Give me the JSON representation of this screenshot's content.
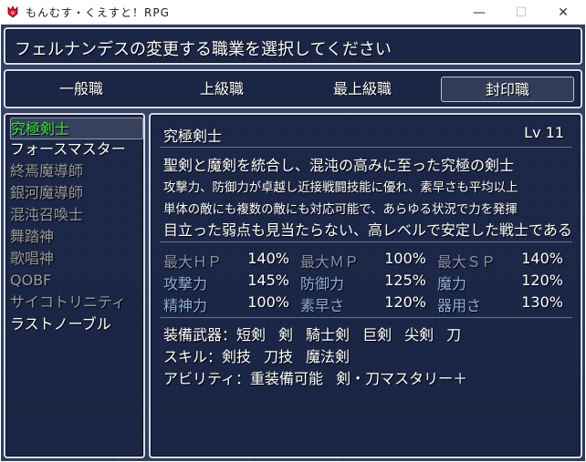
{
  "window": {
    "title": "もんむす・くえすと！RPG",
    "minimize_glyph": "—",
    "maximize_glyph": "☐",
    "close_glyph": "✕"
  },
  "header": {
    "text": "フェルナンデスの変更する職業を選択してください"
  },
  "tabs": [
    {
      "label": "一般職",
      "selected": false
    },
    {
      "label": "上級職",
      "selected": false
    },
    {
      "label": "最上級職",
      "selected": false
    },
    {
      "label": "封印職",
      "selected": true
    }
  ],
  "job_list": [
    {
      "label": "究極剣士",
      "color": "#40e040",
      "selected": true
    },
    {
      "label": "フォースマスター",
      "color": "#ffffff",
      "selected": false
    },
    {
      "label": "終焉魔導師",
      "color": "#9a9a9a",
      "selected": false
    },
    {
      "label": "銀河魔導師",
      "color": "#9a9a9a",
      "selected": false
    },
    {
      "label": "混沌召喚士",
      "color": "#9a9a9a",
      "selected": false
    },
    {
      "label": "舞踏神",
      "color": "#9a9a9a",
      "selected": false
    },
    {
      "label": "歌唱神",
      "color": "#9a9a9a",
      "selected": false
    },
    {
      "label": "QOBF",
      "color": "#9a9a9a",
      "selected": false
    },
    {
      "label": "サイコトリニティ",
      "color": "#9a9a9a",
      "selected": false
    },
    {
      "label": "ラストノーブル",
      "color": "#ffffff",
      "selected": false
    }
  ],
  "detail": {
    "name": "究極剣士",
    "level": "Lv 11",
    "desc1": "聖剣と魔剣を統合し、混沌の高みに至った究極の剣士",
    "desc2": "攻撃力、防御力が卓越し近接戦闘技能に優れ、素早さも平均以上",
    "desc3": "単体の敵にも複数の敵にも対応可能で、あらゆる状況で力を発揮",
    "desc4": "目立った弱点も見当たらない、高レベルで安定した戦士である",
    "stats": [
      {
        "label": "最大ＨＰ",
        "value": "140%",
        "color": "#8a94a8"
      },
      {
        "label": "最大ＭＰ",
        "value": "100%",
        "color": "#8a94a8"
      },
      {
        "label": "最大ＳＰ",
        "value": "140%",
        "color": "#8a94a8"
      },
      {
        "label": "攻撃力",
        "value": "145%",
        "color": "#8fb0e0"
      },
      {
        "label": "防御力",
        "value": "125%",
        "color": "#8fb0e0"
      },
      {
        "label": "魔力",
        "value": "120%",
        "color": "#8fb0e0"
      },
      {
        "label": "精神力",
        "value": "100%",
        "color": "#8fb0e0"
      },
      {
        "label": "素早さ",
        "value": "120%",
        "color": "#8fb0e0"
      },
      {
        "label": "器用さ",
        "value": "130%",
        "color": "#8fb0e0"
      }
    ],
    "weapons_label": "装備武器：",
    "weapons": [
      "短剣",
      "剣",
      "騎士剣",
      "巨剣",
      "尖剣",
      "刀"
    ],
    "skills_label": "スキル：",
    "skills": [
      "剣技",
      "刀技",
      "魔法剣"
    ],
    "abilities_label": "アビリティ：",
    "abilities": [
      "重装備可能",
      "剣・刀マスタリー＋"
    ]
  }
}
